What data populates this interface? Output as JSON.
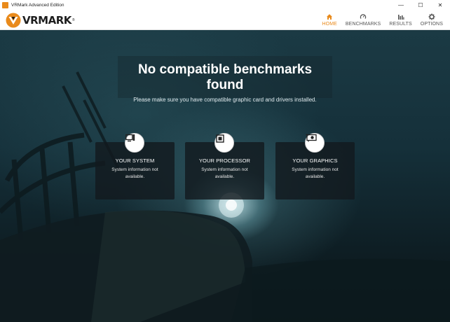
{
  "window": {
    "title": "VRMark Advanced Edition",
    "controls": {
      "minimize": "—",
      "maximize": "☐",
      "close": "✕"
    }
  },
  "header": {
    "logo_text": "VRMARK",
    "logo_reg": "®",
    "accent_color": "#e98a1b",
    "nav": [
      {
        "label": "HOME",
        "icon": "home-icon",
        "active": true
      },
      {
        "label": "BENCHMARKS",
        "icon": "gauge-icon",
        "active": false
      },
      {
        "label": "RESULTS",
        "icon": "bar-chart-icon",
        "active": false
      },
      {
        "label": "OPTIONS",
        "icon": "gear-icon",
        "active": false
      }
    ]
  },
  "main": {
    "title": "No compatible benchmarks found",
    "subtitle": "Please make sure you have compatible graphic card and drivers installed.",
    "cards": [
      {
        "title": "YOUR SYSTEM",
        "text": "System information not available.",
        "icon": "computer-icon"
      },
      {
        "title": "YOUR PROCESSOR",
        "text": "System information not available.",
        "icon": "processor-icon"
      },
      {
        "title": "YOUR GRAPHICS",
        "text": "System information not available.",
        "icon": "graphics-card-icon"
      }
    ]
  }
}
